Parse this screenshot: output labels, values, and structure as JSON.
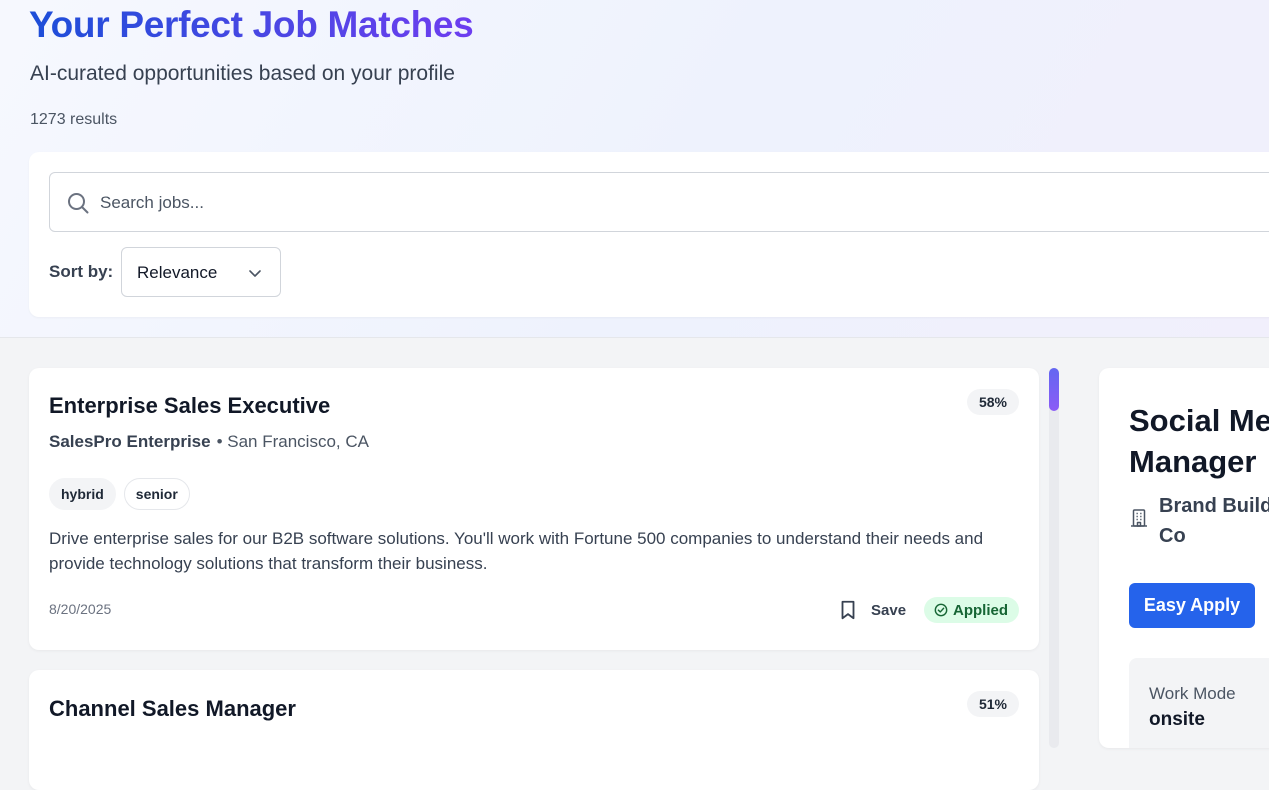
{
  "header": {
    "title": "Your Perfect Job Matches",
    "subtitle": "AI-curated opportunities based on your profile",
    "results": "1273 results"
  },
  "filters": {
    "search_placeholder": "Search jobs...",
    "sort_label": "Sort by:",
    "sort_value": "Relevance"
  },
  "jobs": [
    {
      "title": "Enterprise Sales Executive",
      "match": "58%",
      "company": "SalesPro Enterprise",
      "location": "• San Francisco, CA",
      "tags": [
        "hybrid",
        "senior"
      ],
      "description": "Drive enterprise sales for our B2B software solutions. You'll work with Fortune 500 companies to understand their needs and provide technology solutions that transform their business.",
      "date": "8/20/2025",
      "save_label": "Save",
      "status_label": "Applied"
    },
    {
      "title": "Channel Sales Manager",
      "match": "51%"
    }
  ],
  "detail": {
    "title": "Social Media Manager",
    "company": "Brand Builders Co",
    "apply_label": "Easy Apply",
    "info_label": "Work Mode",
    "info_value": "onsite"
  },
  "scrollbar": {
    "position": 0
  },
  "colors": {
    "accent": "#2563eb",
    "title_gradient_start": "#1d4ed8",
    "title_gradient_end": "#6d3df0",
    "applied_bg": "#dcfce7",
    "applied_text": "#166534"
  }
}
